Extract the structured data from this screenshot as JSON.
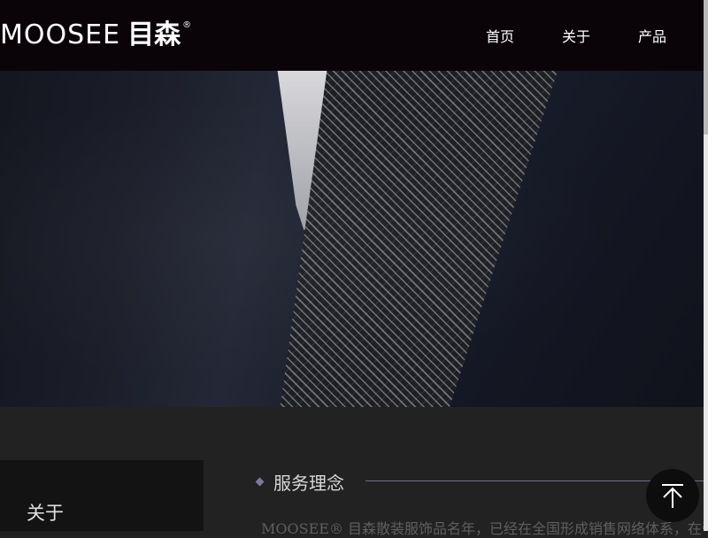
{
  "header": {
    "logo": {
      "latin": "MOOSEE",
      "cjk": "目森",
      "registered": "®"
    },
    "nav": [
      {
        "label": "首页"
      },
      {
        "label": "关于"
      },
      {
        "label": "产品"
      }
    ]
  },
  "sidebar": {
    "title": "关于"
  },
  "section": {
    "title": "服务理念",
    "body": "MOOSEE® 目森散装服饰品名年，已经在全国形成销售网络体系，在帝"
  },
  "colors": {
    "header_bg": "#0a0408",
    "page_bg": "#222222",
    "accent": "#7a7aa0"
  },
  "icons": {
    "back_to_top": "arrow-up-icon",
    "heading_marker": "diamond-icon"
  }
}
